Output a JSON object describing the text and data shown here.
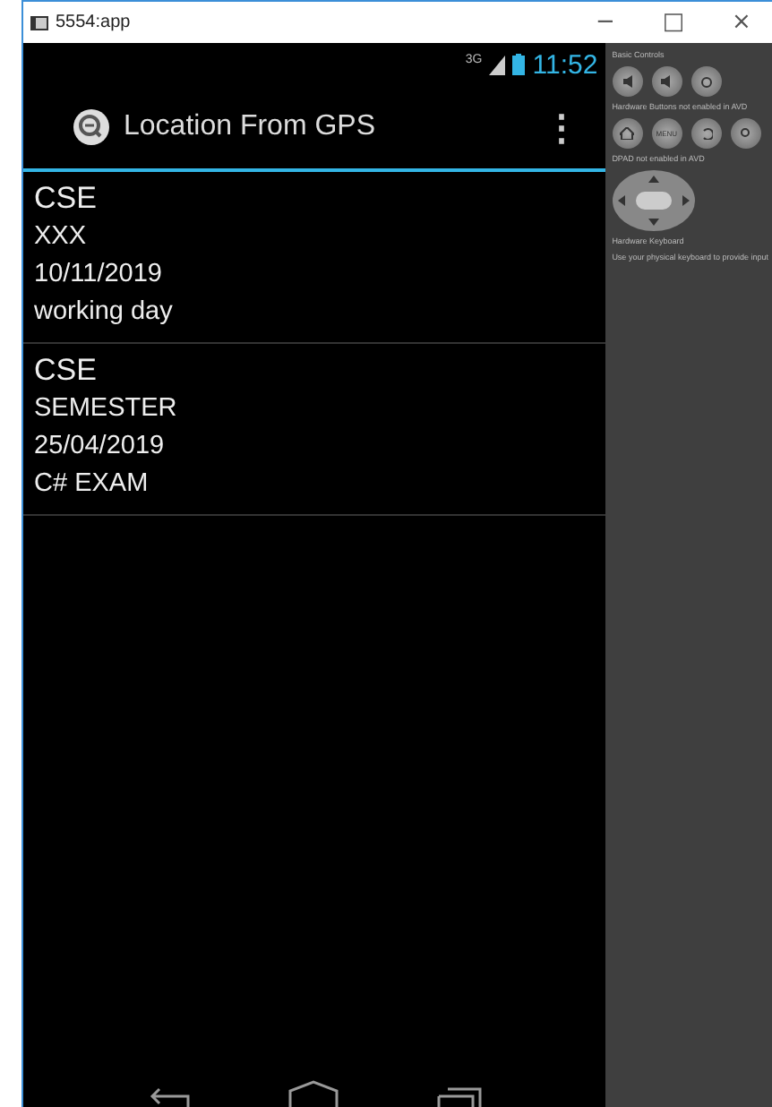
{
  "window": {
    "title": "5554:app",
    "controls": [
      "−",
      "□",
      "×"
    ]
  },
  "status_bar": {
    "network": "3G",
    "time": "11:52"
  },
  "action_bar": {
    "title": "Location From GPS",
    "menu": "⋮"
  },
  "items": [
    {
      "lines": [
        "CSE",
        "XXX",
        "10/11/2019",
        "working day"
      ]
    },
    {
      "lines": [
        "CSE",
        "SEMESTER",
        "25/04/2019",
        "C# EXAM"
      ]
    }
  ],
  "side_panel": {
    "basic_controls": "Basic Controls",
    "hardware_buttons": "Hardware Buttons",
    "hardware_note": "not enabled in AVD",
    "menu_key": "MENU",
    "dpad": "DPAD",
    "dpad_note": "not enabled in AVD",
    "keyboard": "Hardware Keyboard",
    "keyboard_note": "Use your physical keyboard to provide input"
  }
}
